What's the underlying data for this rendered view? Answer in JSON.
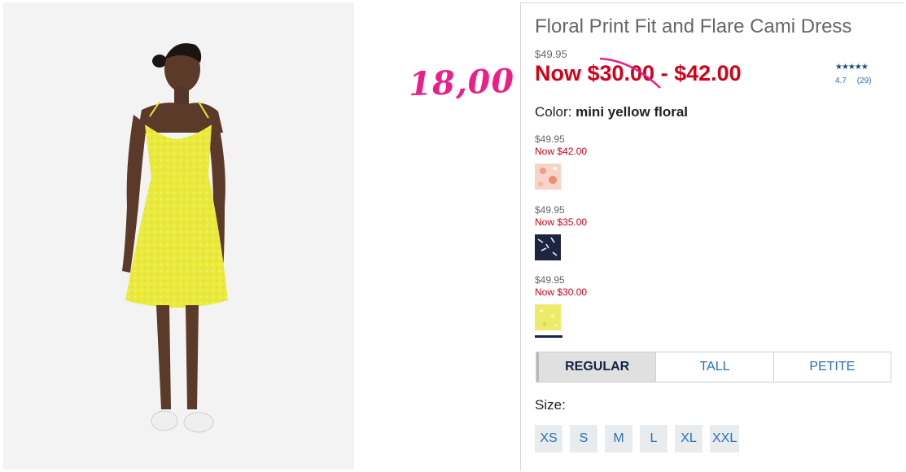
{
  "product": {
    "title": "Floral Print Fit and Flare Cami Dress",
    "original_price": "$49.95",
    "sale_price": "Now $30.00 - $42.00",
    "image_alt": "model wearing yellow floral cami dress"
  },
  "annotation": {
    "text": "18,00",
    "color": "#ea1f8a"
  },
  "rating": {
    "stars": "★★★★★",
    "value": "4.7",
    "count": "(29)",
    "stars_level": 4.7
  },
  "color": {
    "label": "Color:",
    "value": "mini yellow floral"
  },
  "swatches": [
    {
      "original": "$49.95",
      "now": "Now $42.00",
      "name": "pink floral swatch",
      "color": "#f6c9bd"
    },
    {
      "original": "$49.95",
      "now": "Now $35.00",
      "name": "navy floral swatch",
      "color": "#1d2440"
    },
    {
      "original": "$49.95",
      "now": "Now $30.00",
      "name": "yellow floral swatch",
      "color": "#ecec6a",
      "selected": true
    }
  ],
  "fit_tabs": [
    {
      "label": "REGULAR",
      "active": true
    },
    {
      "label": "TALL",
      "active": false
    },
    {
      "label": "PETITE",
      "active": false
    }
  ],
  "size": {
    "label": "Size:",
    "options": [
      "XS",
      "S",
      "M",
      "L",
      "XL",
      "XXL"
    ]
  },
  "colors": {
    "sale_red": "#d0021b",
    "link_blue": "#2a6fb3",
    "navy": "#122344"
  }
}
